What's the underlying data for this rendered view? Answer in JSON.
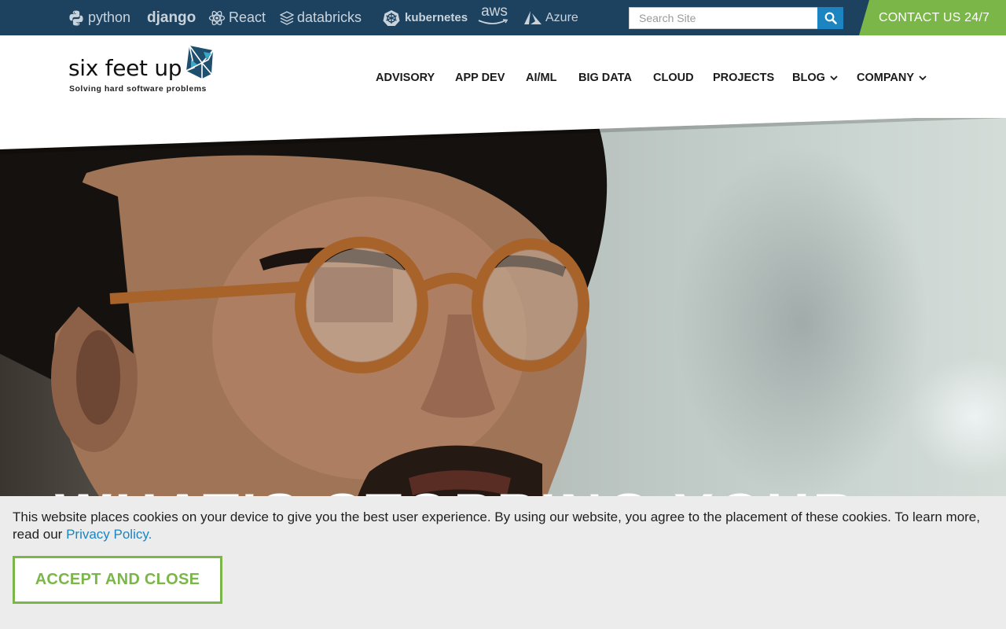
{
  "topbar": {
    "tech_logos": [
      {
        "label": "python",
        "icon": "python-icon"
      },
      {
        "label": "django",
        "icon": ""
      },
      {
        "label": "React",
        "icon": "react-icon"
      },
      {
        "label": "databricks",
        "icon": "databricks-icon"
      },
      {
        "label": "kubernetes",
        "icon": "kubernetes-icon"
      },
      {
        "label": "aws",
        "icon": "aws-smile-icon"
      },
      {
        "label": "Azure",
        "icon": "azure-icon"
      }
    ],
    "search": {
      "placeholder": "Search Site",
      "value": "",
      "icon": "search-icon"
    },
    "contact_label": "CONTACT US 24/7"
  },
  "header": {
    "logo": {
      "name": "six feet up",
      "tagline": "Solving hard software problems"
    },
    "nav": [
      {
        "label": "ADVISORY"
      },
      {
        "label": "APP DEV"
      },
      {
        "label": "AI/ML"
      },
      {
        "label": "BIG DATA"
      },
      {
        "label": "CLOUD"
      },
      {
        "label": "PROJECTS"
      },
      {
        "label": "BLOG",
        "has_dropdown": true
      },
      {
        "label": "COMPANY",
        "has_dropdown": true
      }
    ]
  },
  "hero": {
    "heading": "WHAT'S STOPPING YOUR"
  },
  "cookie_banner": {
    "text": "This website places cookies on your device to give you the best user experience. By using our website, you agree to the placement of these cookies. To learn more, read our",
    "link_label": "Privacy Policy.",
    "button_label": "ACCEPT AND CLOSE"
  },
  "colors": {
    "topbar_bg": "#1d4260",
    "accent_green": "#7ab648",
    "accent_blue": "#1c84c0",
    "cookie_bg": "#ececec"
  }
}
